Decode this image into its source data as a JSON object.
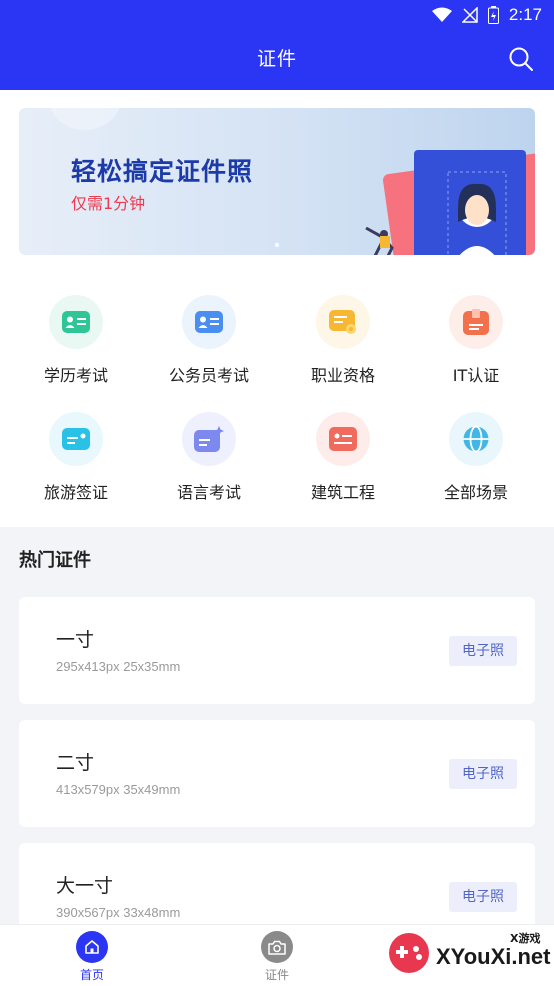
{
  "status_bar": {
    "time": "2:17"
  },
  "header": {
    "title": "证件"
  },
  "banner": {
    "title": "轻松搞定证件照",
    "subtitle": "仅需1分钟"
  },
  "categories": [
    {
      "label": "学历考试",
      "icon": "id-card-icon",
      "color": "#2fc596",
      "bg": "#e9f8f2"
    },
    {
      "label": "公务员考试",
      "icon": "id-card-icon",
      "color": "#4a8ff0",
      "bg": "#ebf3fd"
    },
    {
      "label": "职业资格",
      "icon": "certificate-icon",
      "color": "#f7b733",
      "bg": "#fef6e6"
    },
    {
      "label": "IT认证",
      "icon": "badge-icon",
      "color": "#f2704b",
      "bg": "#feeee9"
    },
    {
      "label": "旅游签证",
      "icon": "travel-card-icon",
      "color": "#29c1e6",
      "bg": "#e8f8fc"
    },
    {
      "label": "语言考试",
      "icon": "language-card-icon",
      "color": "#7d89ee",
      "bg": "#eef0fd"
    },
    {
      "label": "建筑工程",
      "icon": "construction-card-icon",
      "color": "#f06a5e",
      "bg": "#feecea"
    },
    {
      "label": "全部场景",
      "icon": "globe-icon",
      "color": "#43b6e8",
      "bg": "#e9f6fc"
    }
  ],
  "hot_section": {
    "title": "热门证件"
  },
  "cards": [
    {
      "name": "一寸",
      "spec": "295x413px 25x35mm",
      "badge": "电子照"
    },
    {
      "name": "二寸",
      "spec": "413x579px 35x49mm",
      "badge": "电子照"
    },
    {
      "name": "大一寸",
      "spec": "390x567px 33x48mm",
      "badge": "电子照"
    }
  ],
  "tabs": [
    {
      "label": "首页",
      "icon": "home-icon",
      "active": true
    },
    {
      "label": "证件",
      "icon": "camera-icon",
      "active": false
    }
  ],
  "watermark": {
    "text": "XYouXi.net",
    "small": "X游戏"
  },
  "colors": {
    "primary": "#2b36f4",
    "badge_text": "#5266c8"
  }
}
